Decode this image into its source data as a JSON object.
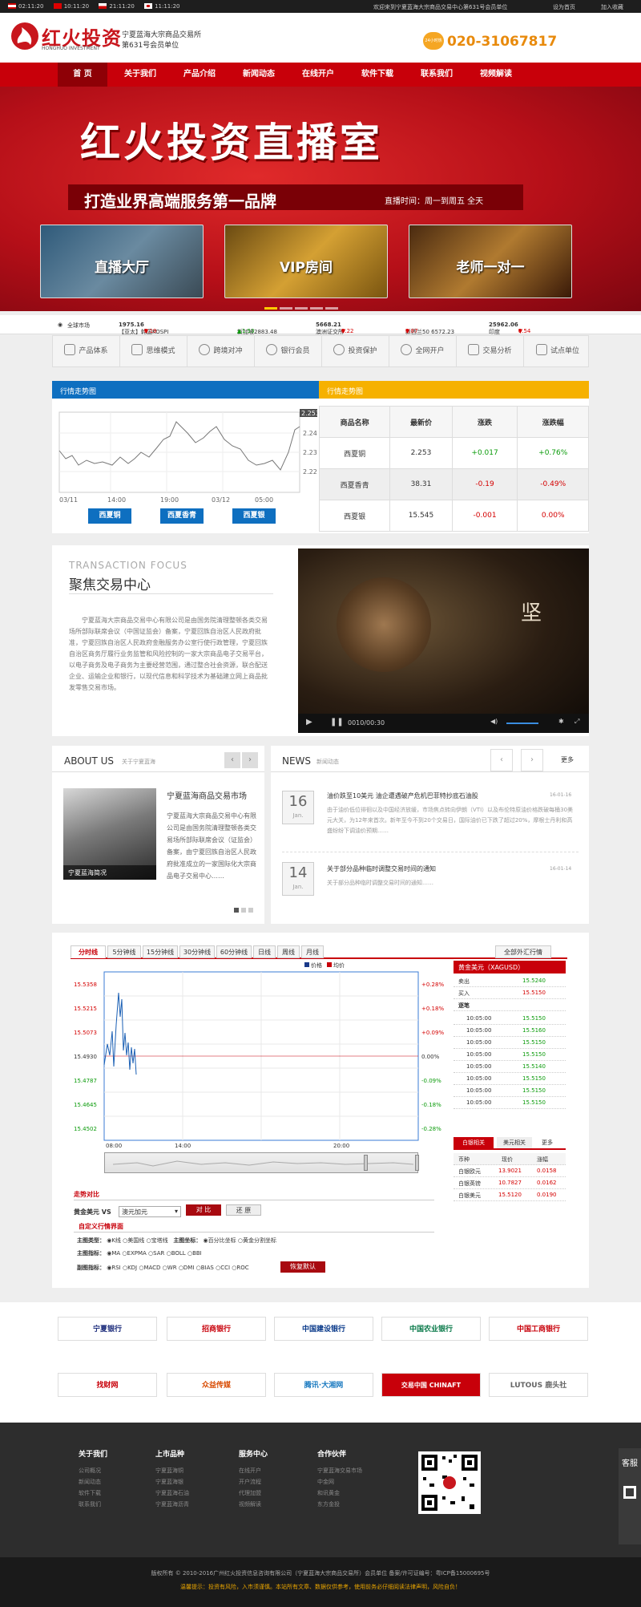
{
  "topbar": {
    "clocks": [
      {
        "flag": "uk",
        "time": "02:11:20"
      },
      {
        "flag": "cn",
        "time": "10:11:20"
      },
      {
        "flag": "us",
        "time": "21:11:20"
      },
      {
        "flag": "jp",
        "time": "11:11:20"
      }
    ],
    "welcome": "欢迎来到宁夏蓝海大宗商品交易中心第631号会员单位",
    "home": "设为首页",
    "fav": "加入收藏"
  },
  "header": {
    "logo_cn": "红火投资",
    "logo_en": "HONGHUO INVESTMENT",
    "sub1": "宁夏蓝海大宗商品交易所",
    "sub2": "第631号会员单位",
    "phone": "020-31067817",
    "phone_badge": "24小时热线"
  },
  "nav": [
    "首 页",
    "关于我们",
    "产品介绍",
    "新闻动态",
    "在线开户",
    "软件下载",
    "联系我们",
    "视频解读"
  ],
  "banner": {
    "title": "红火投资直播室",
    "slogan": "打造业界高端服务第一品牌",
    "time": "直播时间：周一到周五 全天",
    "tiles": [
      "直播大厅",
      "VIP房间",
      "老师一对一"
    ]
  },
  "ticker": [
    {
      "name": "全球市场",
      "val": "",
      "chg": "",
      "c": ""
    },
    {
      "name": "【亚太】韩国KOSPI",
      "val": "1975.16",
      "chg": "0.19",
      "c": "dn"
    },
    {
      "name": "新加坡2883.48",
      "val": "",
      "chg": "+1.53",
      "c": "up"
    },
    {
      "name": "澳洲证交所",
      "val": "5668.21",
      "chg": "0.22",
      "c": "dn"
    },
    {
      "name": "新西兰50 6572.23",
      "val": "",
      "chg": "0.87",
      "c": "dn"
    },
    {
      "name": "印度",
      "val": "25962.06",
      "chg": "0.54",
      "c": "dn"
    }
  ],
  "quicknav": [
    "产品体系",
    "思维模式",
    "跨境对冲",
    "银行会员",
    "投资保护",
    "全网开户",
    "交易分析",
    "试点单位"
  ],
  "market": {
    "chart_title": "行情走势图",
    "table_title": "行情走势图",
    "yticks": [
      "2.25",
      "2.24",
      "2.23",
      "2.22"
    ],
    "current": "2.253",
    "xticks": [
      "03/11",
      "14:00",
      "19:00",
      "03/12",
      "05:00"
    ],
    "buttons": [
      "西夏铜",
      "西夏香青",
      "西夏银"
    ],
    "columns": [
      "商品名称",
      "最新价",
      "涨跌",
      "涨跌幅"
    ],
    "rows": [
      {
        "name": "西夏铜",
        "price": "2.253",
        "chg": "+0.017",
        "pct": "+0.76%",
        "c": "up"
      },
      {
        "name": "西夏香青",
        "price": "38.31",
        "chg": "-0.19",
        "pct": "-0.49%",
        "c": "dn"
      },
      {
        "name": "西夏银",
        "price": "15.545",
        "chg": "-0.001",
        "pct": "0.00%",
        "c": "dn"
      }
    ]
  },
  "focus": {
    "en": "TRANSACTION FOCUS",
    "cn": "聚焦交易中心",
    "text": "宁夏蓝海大宗商品交易中心有限公司是由国务院清理整顿各类交易场所部际联席会议（中国证监会）备案，宁夏回族自治区人民政府批准，宁夏回族自治区人民政府金融服务办公室行使行政管理，宁夏回族自治区商务厅履行业务监管和风险控制的一家大宗商品电子交易平台，以电子商务及电子商务为主要经营范围，通过整合社会资源，联合配送企业、运输企业和银行，以现代信息和科学技术为基础建立网上商品批发零售交易市场。",
    "slogan": "坚",
    "time": "0010/00:30"
  },
  "about": {
    "title": "ABOUT US",
    "sub": "关于宁夏蓝海",
    "img_cap": "宁夏蓝海简况",
    "head": "宁夏蓝海商品交易市场",
    "text": "宁夏蓝海大宗商品交易中心有限公司是由国务院清理整顿各类交易场所部际联席会议（证监会）备案，由宁夏回族自治区人民政府批准成立的一家国际化大宗商品电子交易中心……"
  },
  "news": {
    "title": "NEWS",
    "sub": "新闻动态",
    "more": "更多",
    "items": [
      {
        "day": "16",
        "mon": "Jan.",
        "head": "油价跌至10美元 油企遭遇破产危机巴菲特抄底石油股",
        "date": "16-01-16",
        "text": "由于油价低位徘徊以及中国经济放缓，市场焦点转向伊朗（VTI）以及布伦特原油价格跌破每桶30美元大关，为12年来首次。新年至今不到20个交易日，国际油价已下跌了超过20%，摩根士丹利和高盛纷纷下调油价预期……"
      },
      {
        "day": "14",
        "mon": "Jan.",
        "head": "关于部分品种临时调整交易时间的通知",
        "date": "16-01-14",
        "text": "关于部分品种临时调整交易时间的通知……"
      }
    ]
  },
  "kline": {
    "tabs": [
      "分时线",
      "5分钟线",
      "15分钟线",
      "30分钟线",
      "60分钟线",
      "日线",
      "周线",
      "月线"
    ],
    "all_btn": "全部外汇行情",
    "legend": [
      "价格",
      "均价"
    ],
    "yleft": [
      "15.5358",
      "15.5215",
      "15.5073",
      "15.4930",
      "15.4787",
      "15.4645",
      "15.4502"
    ],
    "yright": [
      "+0.28%",
      "+0.18%",
      "+0.09%",
      "0.00%",
      "-0.09%",
      "-0.18%",
      "-0.28%"
    ],
    "xticks": [
      "08:00",
      "14:00",
      "20:00"
    ],
    "compare": "走势对比",
    "pair_label": "黄金美元 VS",
    "select": "澳元加元",
    "btn_cmp": "对 比",
    "btn_reset": "还 原",
    "custom": "自定义行情界面",
    "r1_label": "主图类型：",
    "r1": [
      "K线",
      "美国线",
      "宝塔线"
    ],
    "r1b_label": "主图坐标：",
    "r1b": [
      "百分比坐标",
      "黄金分割坐标"
    ],
    "r2_label": "主图指标：",
    "r2": [
      "MA",
      "EXPMA",
      "SAR",
      "BOLL",
      "BBI"
    ],
    "r3_label": "副图指标：",
    "r3": [
      "RSI",
      "KDJ",
      "MACD",
      "WR",
      "DMI",
      "BIAS",
      "CCI",
      "ROC"
    ],
    "restore": "恢复默认"
  },
  "quote": {
    "title": "黄金美元（XAGUSD）",
    "sell_label": "卖出",
    "sell": "15.5240",
    "buy_label": "买入",
    "buy": "15.5150",
    "ticks_label": "逐笔",
    "ticks": [
      [
        "10:05:00",
        "15.5150"
      ],
      [
        "10:05:00",
        "15.5160"
      ],
      [
        "10:05:00",
        "15.5150"
      ],
      [
        "10:05:00",
        "15.5150"
      ],
      [
        "10:05:00",
        "15.5140"
      ],
      [
        "10:05:00",
        "15.5150"
      ],
      [
        "10:05:00",
        "15.5150"
      ],
      [
        "10:05:00",
        "15.5150"
      ]
    ],
    "tabs": [
      "白银相关",
      "美元相关",
      "更多"
    ],
    "cols": [
      "币种",
      "现价",
      "涨幅"
    ],
    "rows": [
      [
        "白银欧元",
        "13.9021",
        "0.0158"
      ],
      [
        "白银英镑",
        "10.7827",
        "0.0162"
      ],
      [
        "白银美元",
        "15.5120",
        "0.0190"
      ]
    ]
  },
  "partners": [
    "宁夏银行",
    "招商银行",
    "中国建设银行",
    "中国农业银行",
    "中国工商银行",
    "找财网",
    "众益传媒",
    "腾讯·大湘网",
    "交易中国 CHINAFT",
    "LUTOUS 鹿头社"
  ],
  "footer": {
    "cols": [
      {
        "h": "关于我们",
        "items": [
          "公司概况",
          "新闻动态",
          "软件下载",
          "联系我们"
        ]
      },
      {
        "h": "上市品种",
        "items": [
          "宁夏蓝海铜",
          "宁夏蓝海银",
          "宁夏蓝海石油",
          "宁夏蓝海沥青"
        ]
      },
      {
        "h": "服务中心",
        "items": [
          "在线开户",
          "开户流程",
          "代理加盟",
          "视频解读"
        ]
      },
      {
        "h": "合作伙伴",
        "items": [
          "宁夏蓝海交易市场",
          "中金网",
          "和讯黄金",
          "东方金投"
        ]
      }
    ],
    "side": "客服",
    "copy1": "版权所有 © 2010-2016广州红火投资信息咨询有限公司（宁夏蓝海大宗商品交易所）会员单位  备案/许可证编号：粤ICP备15000695号",
    "copy2": "温馨提示：投资有风险，入市须谨慎。本站所有文章、数据仅供参考，使用前务必仔细阅读法律声明，风险自负！"
  }
}
